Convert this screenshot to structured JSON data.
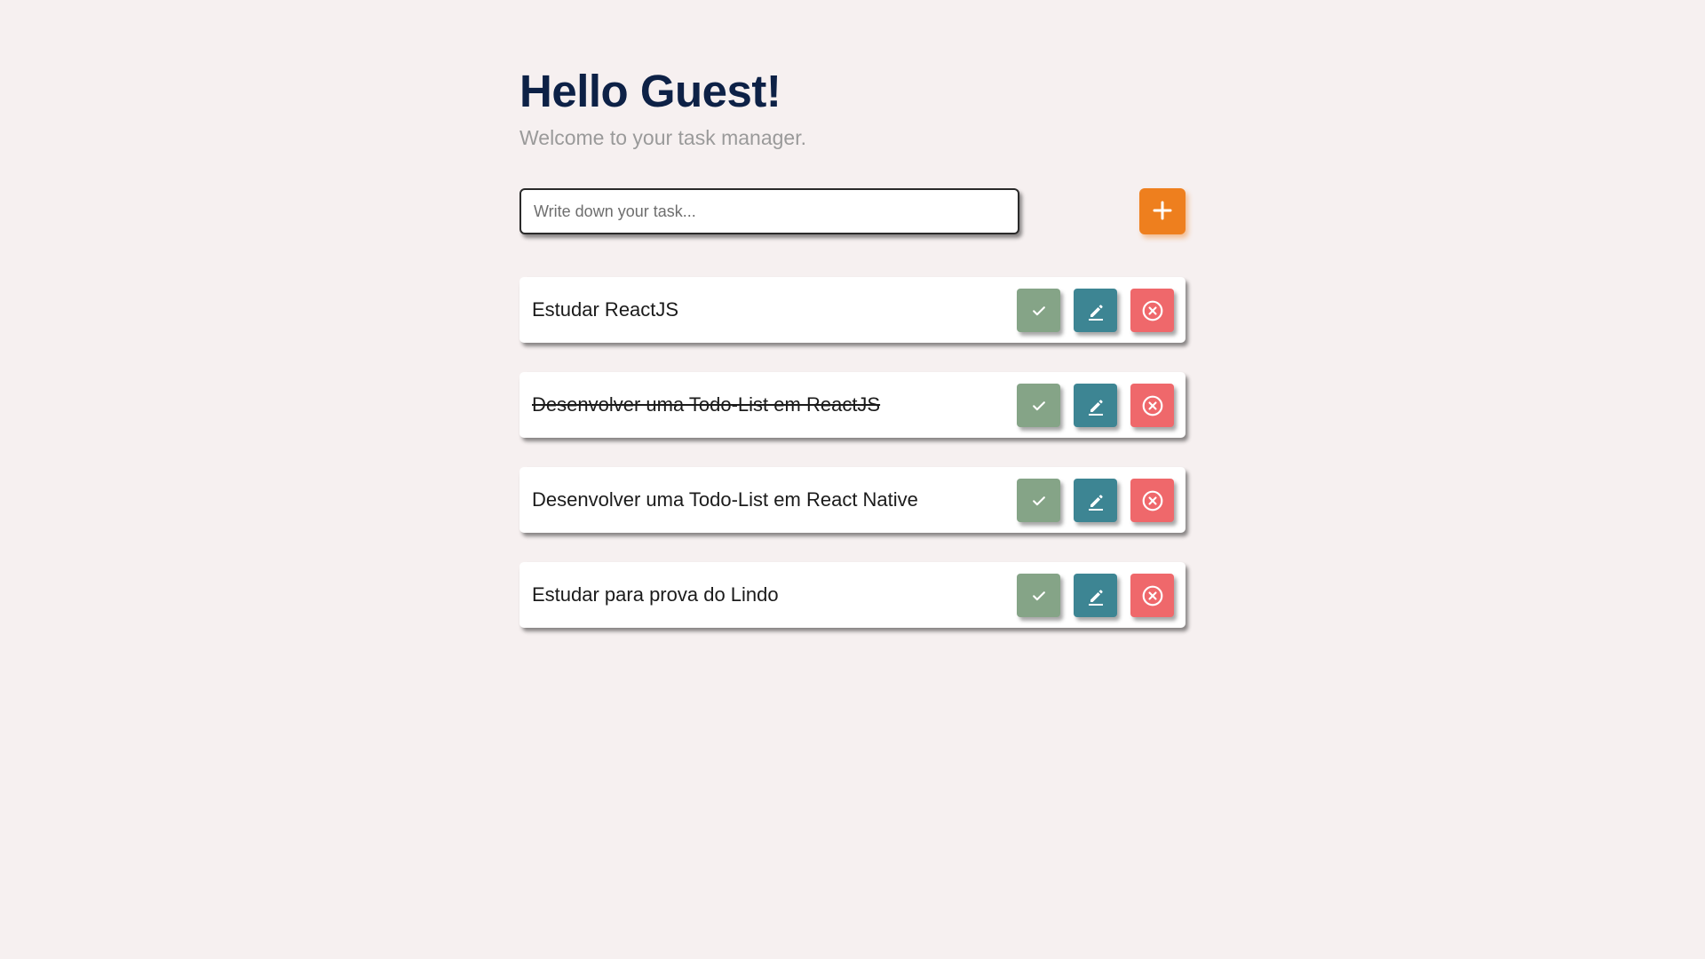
{
  "header": {
    "title": "Hello Guest!",
    "subtitle": "Welcome to your task manager."
  },
  "new_task": {
    "placeholder": "Write down your task...",
    "value": "",
    "add_icon": "plus-icon"
  },
  "tasks": [
    {
      "text": "Estudar ReactJS",
      "done": false
    },
    {
      "text": "Desenvolver uma Todo-List em ReactJS",
      "done": true
    },
    {
      "text": "Desenvolver uma Todo-List em React Native",
      "done": false
    },
    {
      "text": "Estudar para prova do Lindo",
      "done": false
    }
  ],
  "actions": {
    "complete_icon": "check-icon",
    "edit_icon": "pencil-icon",
    "delete_icon": "close-circle-icon"
  },
  "colors": {
    "background": "#f6f0f0",
    "title": "#0d2146",
    "accent": "#ee7f1e",
    "complete": "#85a487",
    "edit": "#3d8593",
    "delete": "#ef686b"
  }
}
